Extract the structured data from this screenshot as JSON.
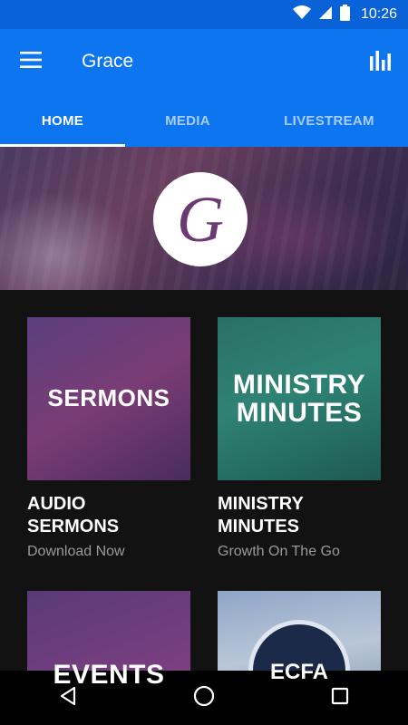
{
  "status_bar": {
    "time": "10:26"
  },
  "app_bar": {
    "title": "Grace"
  },
  "tabs": [
    {
      "label": "HOME",
      "active": true
    },
    {
      "label": "MEDIA",
      "active": false
    },
    {
      "label": "LIVESTREAM",
      "active": false
    }
  ],
  "hero": {
    "logo_letter": "G"
  },
  "cards": [
    {
      "image_text": "SERMONS",
      "title_line1": "AUDIO",
      "title_line2": "SERMONS",
      "subtitle": "Download Now"
    },
    {
      "image_text_line1": "MINISTRY",
      "image_text_line2": "MINUTES",
      "title_line1": "MINISTRY",
      "title_line2": "MINUTES",
      "subtitle": "Growth On The Go"
    },
    {
      "image_text": "EVENTS"
    },
    {
      "image_text": "ECFA"
    }
  ],
  "colors": {
    "primary": "#0e75f0",
    "status_bar": "#0a62d8",
    "background": "#121212",
    "subtitle": "#9a9a9a"
  },
  "icons": [
    "wifi-icon",
    "signal-icon",
    "battery-icon",
    "menu-icon",
    "bar-chart-icon",
    "back-icon",
    "home-icon",
    "recents-icon"
  ]
}
